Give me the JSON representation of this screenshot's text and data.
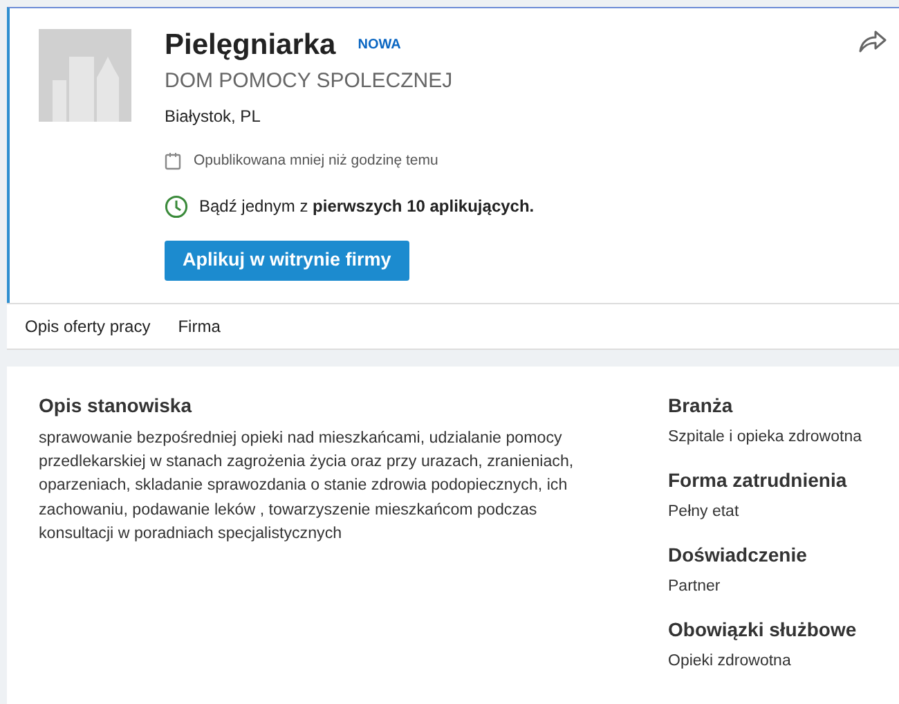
{
  "job": {
    "title": "Pielęgniarka",
    "badge": "NOWA",
    "company": "DOM POMOCY SPOLECZNEJ",
    "location": "Białystok, PL",
    "posted": "Opublikowana mniej niż godzinę temu",
    "applicants": "Bądź jednym z **pierwszych 10 aplikujących.**",
    "apply_button": "Aplikuj w witrynie firmy"
  },
  "tabs": [
    {
      "label": "Opis oferty pracy"
    },
    {
      "label": "Firma"
    }
  ],
  "description": {
    "heading": "Opis stanowiska",
    "text": "sprawowanie bezpośredniej opieki nad mieszkańcami, udzialanie pomocy przedlekarskiej w stanach zagrożenia życia oraz przy urazach, zranieniach, oparzeniach, skladanie sprawozdania o stanie zdrowia podopiecznych, ich zachowaniu, podawanie leków , towarzyszenie mieszkańcom podczas konsultacji w poradniach specjalistycznych"
  },
  "details": [
    {
      "heading": "Branża",
      "value": "Szpitale i opieka zdrowotna"
    },
    {
      "heading": "Forma zatrudnienia",
      "value": "Pełny etat"
    },
    {
      "heading": "Doświadczenie",
      "value": "Partner"
    },
    {
      "heading": "Obowiązki służbowe",
      "value": "Opieki zdrowotna"
    }
  ]
}
